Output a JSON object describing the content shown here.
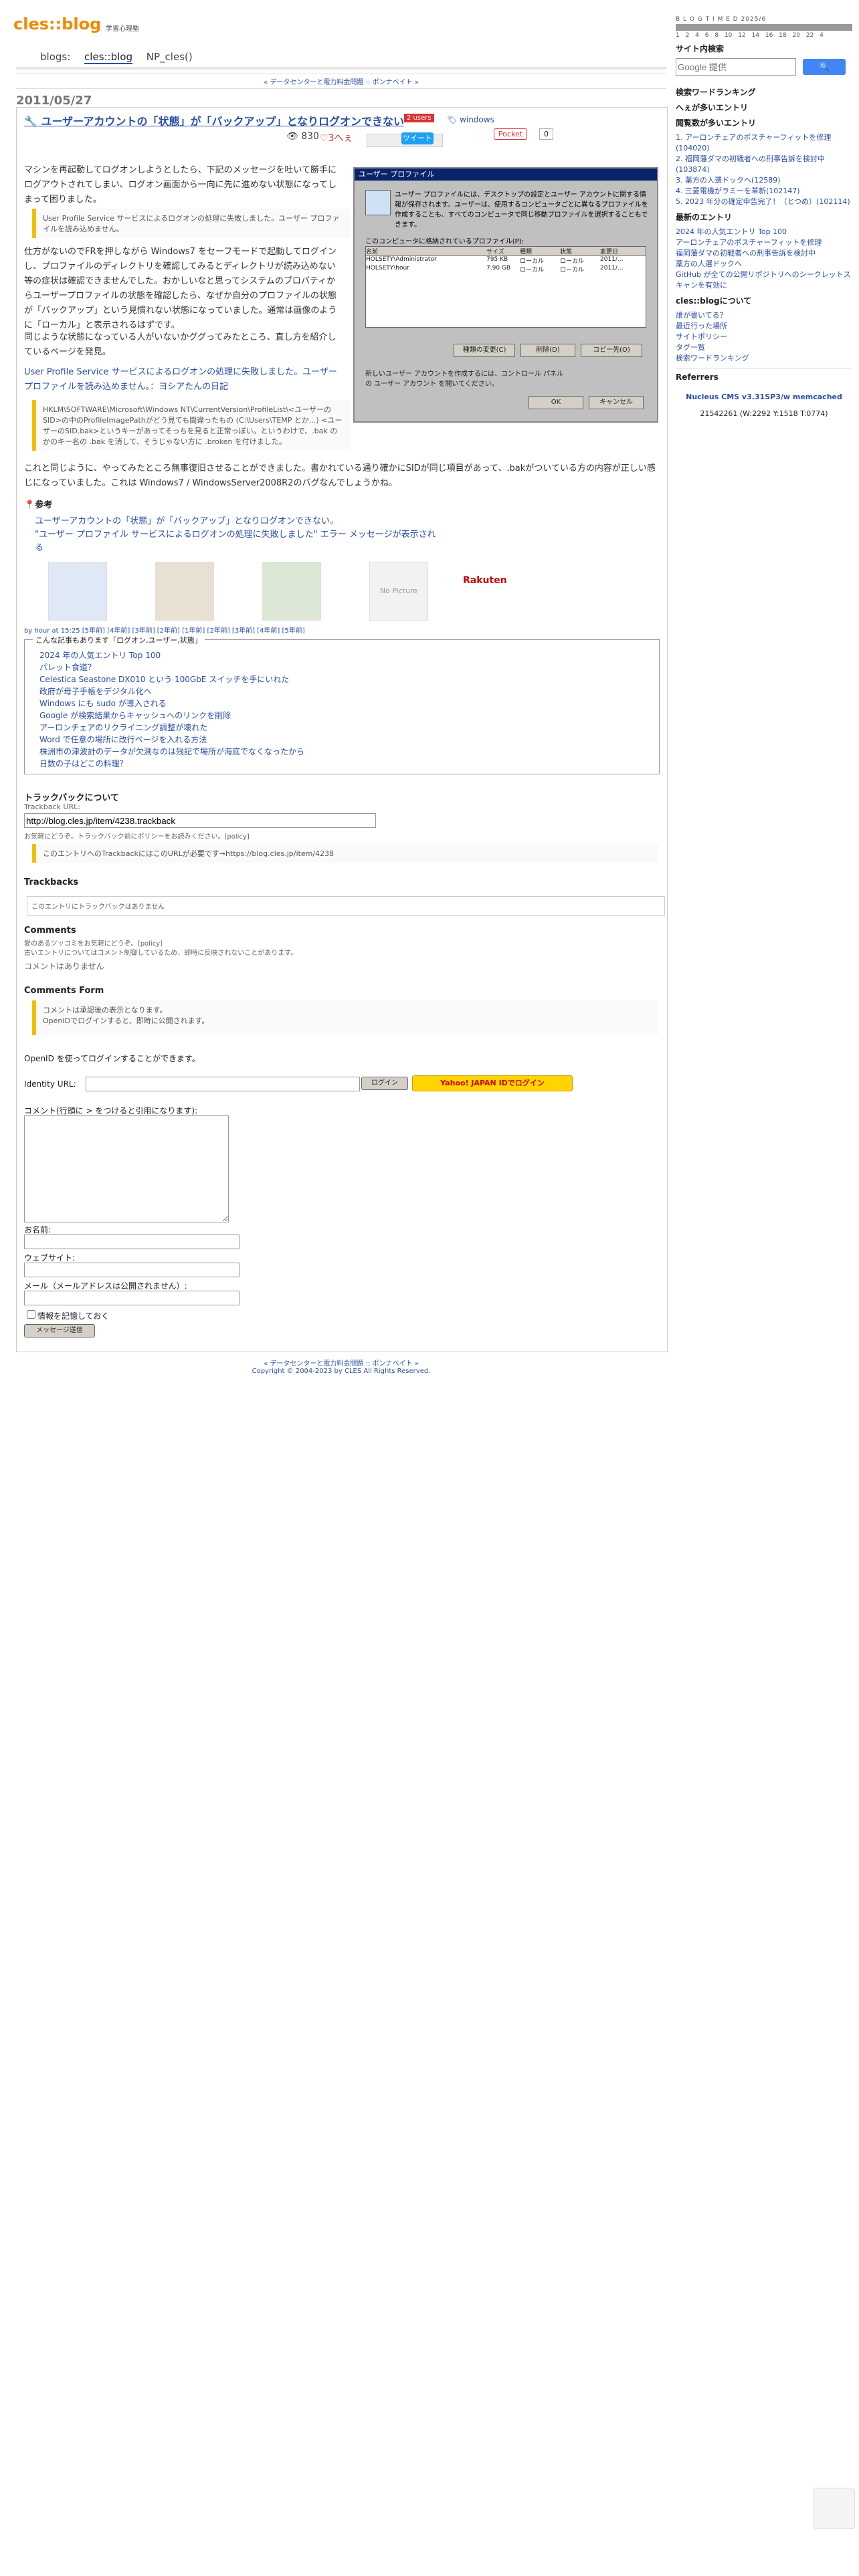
{
  "header": {
    "logo": "cles::blog",
    "subtitle": "学習心理塾"
  },
  "nav": {
    "prefix": "blogs:",
    "item1": "cles::blog",
    "item2": "NP_cles()"
  },
  "banner": "« データセンターと電力料金問題 :: ポンナベイト »",
  "post": {
    "date": "2011/05/27",
    "title": "ユーザーアカウントの「状態」が「バックアップ」となりログオンできない",
    "tag_red": "2 users",
    "tag": "windows",
    "views": "830",
    "hearts": "3へぇ",
    "tweet": "ツイート",
    "pocket": "Pocket",
    "pocket_count": "0",
    "p1": "マシンを再起動してログオンしようとしたら、下記のメッセージを吐いて勝手にログアウトされてしまい、ログオン画面から一向に先に進めない状態になってしまって困りました。",
    "q1": "User Profile Service サービスによるログオンの処理に失敗しました。ユーザー プロファイルを読み込めません。",
    "p2": "仕方がないのでFRを押しながら Windows7 をセーフモードで起動してログインし、プロファイルのディレクトリを確認してみるとディレクトリが読み込めない等の症状は確認できませんでした。おかしいなと思ってシステムのプロパティからユーザープロファイルの状態を確認したら、なぜか自分のプロファイルの状態が「バックアップ」という見慣れない状態になっていました。通常は画像のように「ローカル」と表示されるはずです。",
    "p3": "同じような状態になっている人がいないかググってみたところ、直し方を紹介しているページを発見。",
    "link1": "User Profile Service サービスによるログオンの処理に失敗しました。ユーザー プロファイルを読み込めません。：ヨシアたんの日記",
    "q2": "HKLM\\SOFTWARE\\Microsoft\\Windows NT\\CurrentVersion\\ProfileList\\<ユーザーのSID>の中のProfileImagePathがどう見ても間違ったもの (C:\\Users\\TEMP とか...) <ユーザーのSID.bak>というキーがあってそっちを見ると正常っぽい。というわけで、.bak のかのキー名の .bak を消して、そうじゃない方に .broken を付けました。",
    "p4": "これと同じように、やってみたところ無事復旧させることができました。書かれている通り確かにSIDが同じ項目があって、.bakがついている方の内容が正しい感じになっていました。これは Windows7 / WindowsServer2008R2のバグなんでしょうかね。",
    "ref_title": "参考",
    "refs": [
      "ユーザーアカウントの「状態」が「バックアップ」となりログオンできない。",
      "\"ユーザー プロファイル サービスによるログオンの処理に失敗しました\" エラー メッセージが表示される"
    ],
    "meta": "by hour at 15:25 [5年前] [4年前] [3年前] [2年前] [1年前] [2年前] [3年前] [4年前] [5年前]",
    "no_picture": "No Picture",
    "rakuten": "Rakuten"
  },
  "dialog": {
    "title": "ユーザー プロファイル",
    "text": "ユーザー プロファイルには、デスクトップの設定とユーザー アカウントに関する情報が保存されます。ユーザーは、使用するコンピュータごとに異なるプロファイルを作成することも、すべてのコンピュータで同じ移動プロファイルを選択することもできます。",
    "label": "このコンピュータに格納されているプロファイル(P):",
    "cols": [
      "名前",
      "サイズ",
      "種類",
      "状態",
      "変更日"
    ],
    "rows": [
      [
        "HOLSETY\\Administrator",
        "795 KB",
        "ローカル",
        "ローカル",
        "2011/..."
      ],
      [
        "HOLSETY\\hour",
        "7.90 GB",
        "ローカル",
        "ローカル",
        "2011/..."
      ]
    ],
    "btn_change": "種類の変更(C)",
    "btn_delete": "削除(D)",
    "btn_copy": "コピー先(O)",
    "footer": "新しいユーザー アカウントを作成するには、コントロール パネルの ユーザー アカウント を開いてください。",
    "ok": "OK",
    "cancel": "キャンセル"
  },
  "related": {
    "legend": "こんな記事もあります「ログオン,ユーザー,状態」",
    "items": [
      "2024 年の人気エントリ Top 100",
      "パレット食道？",
      "Celestica Seastone DX010 という 100GbE スイッチを手にいれた",
      "政府が母子手帳をデジタル化へ",
      "Windows にも sudo が導入される",
      "Google が検索結果からキャッシュへのリンクを削除",
      "アーロンチェアのリクライニング調整が壊れた",
      "Word で任意の場所に改行ページを入れる方法",
      "株洲市の津波計のデータが欠測なのは残記で場所が海底でなくなったから",
      "日数の子はどこの料理？"
    ]
  },
  "trackback": {
    "heading": "トラックバックについて",
    "url_label": "Trackback URL:",
    "url": "http://blog.cles.jp/item/4238.trackback",
    "note": "お気軽にどうぞ。トラックバック前にポリシーをお読みください。[policy]",
    "quote": "このエントリへのTrackbackにはこのURLが必要です→https://blog.cles.jp/item/4238",
    "tb_heading": "Trackbacks",
    "tb_empty": "このエントリにトラックバックはありません"
  },
  "comments": {
    "heading": "Comments",
    "note1": "愛のあるツッコミをお気軽にどうぞ。[policy]",
    "note2": "古いエントリについてはコメント制御しているため、即時に反映されないことがあります。",
    "empty": "コメントはありません",
    "form_heading": "Comments Form",
    "form_note1": "コメントは承認後の表示となります。",
    "form_note2": "OpenIDでログインすると、即時に公開されます。",
    "openid_text": "OpenID を使ってログインすることができます。",
    "identity_label": "Identity URL:",
    "login_btn": "ログイン",
    "yahoo_btn": "Yahoo! JAPAN IDでログイン",
    "comment_label": "コメント(行頭に > をつけると引用になります):",
    "name_label": "お名前:",
    "web_label": "ウェブサイト:",
    "mail_label": "メール（メールアドレスは公開されません）:",
    "remember": "情報を記憶しておく",
    "submit": "メッセージ送信"
  },
  "footer": {
    "nav": "« データセンターと電力料金問題 :: ポンナベイト »",
    "copy": "Copyright © 2004-2023 by CLES All Rights Reserved."
  },
  "sidebar": {
    "calendar_head": "B L O G T I M E D  2025/6",
    "calendar_days": "1  2  4  6  8  10  12  14  16  18  20  22  4",
    "search_title": "サイト内検索",
    "search_placeholder": "Google 提供",
    "search_btn": "🔍",
    "h1": "検索ワードランキング",
    "h2": "へぇが多いエントリ",
    "h3": "閲覧数が多いエントリ",
    "popular": [
      "1. アーロンチェアのポスチャーフィットを修理(104020)",
      "2. 福岡藩ダマの初戦者への刑事告訴を検討中(103874)",
      "3. 薬方の人選ドックへ(12589)",
      "4. 三菱電機がラミーを革新(102147)",
      "5. 2023 年分の確定申告完了！（とつめ）(102114)"
    ],
    "h4": "最新のエントリ",
    "latest": [
      "2024 年の人気エントリ Top 100",
      "アーロンチェアのポスチャーフィットを修理",
      "福岡藩ダマの初戦者への刑事告訴を検討中",
      "薬方の人選ドックへ",
      "GitHub が全ての公開リポジトリへのシークレットスキャンを有効に"
    ],
    "h5": "cles::blogについて",
    "about": [
      "誰が書いてる？",
      "最近行った場所",
      "サイトポリシー",
      "タグ一覧",
      "検索ワードランキング"
    ],
    "h6": "Referrers",
    "badge": "Nucleus CMS v3.31SP3/w memcached",
    "counter": "21542261 (W:2292 Y:1518 T:0774)"
  }
}
